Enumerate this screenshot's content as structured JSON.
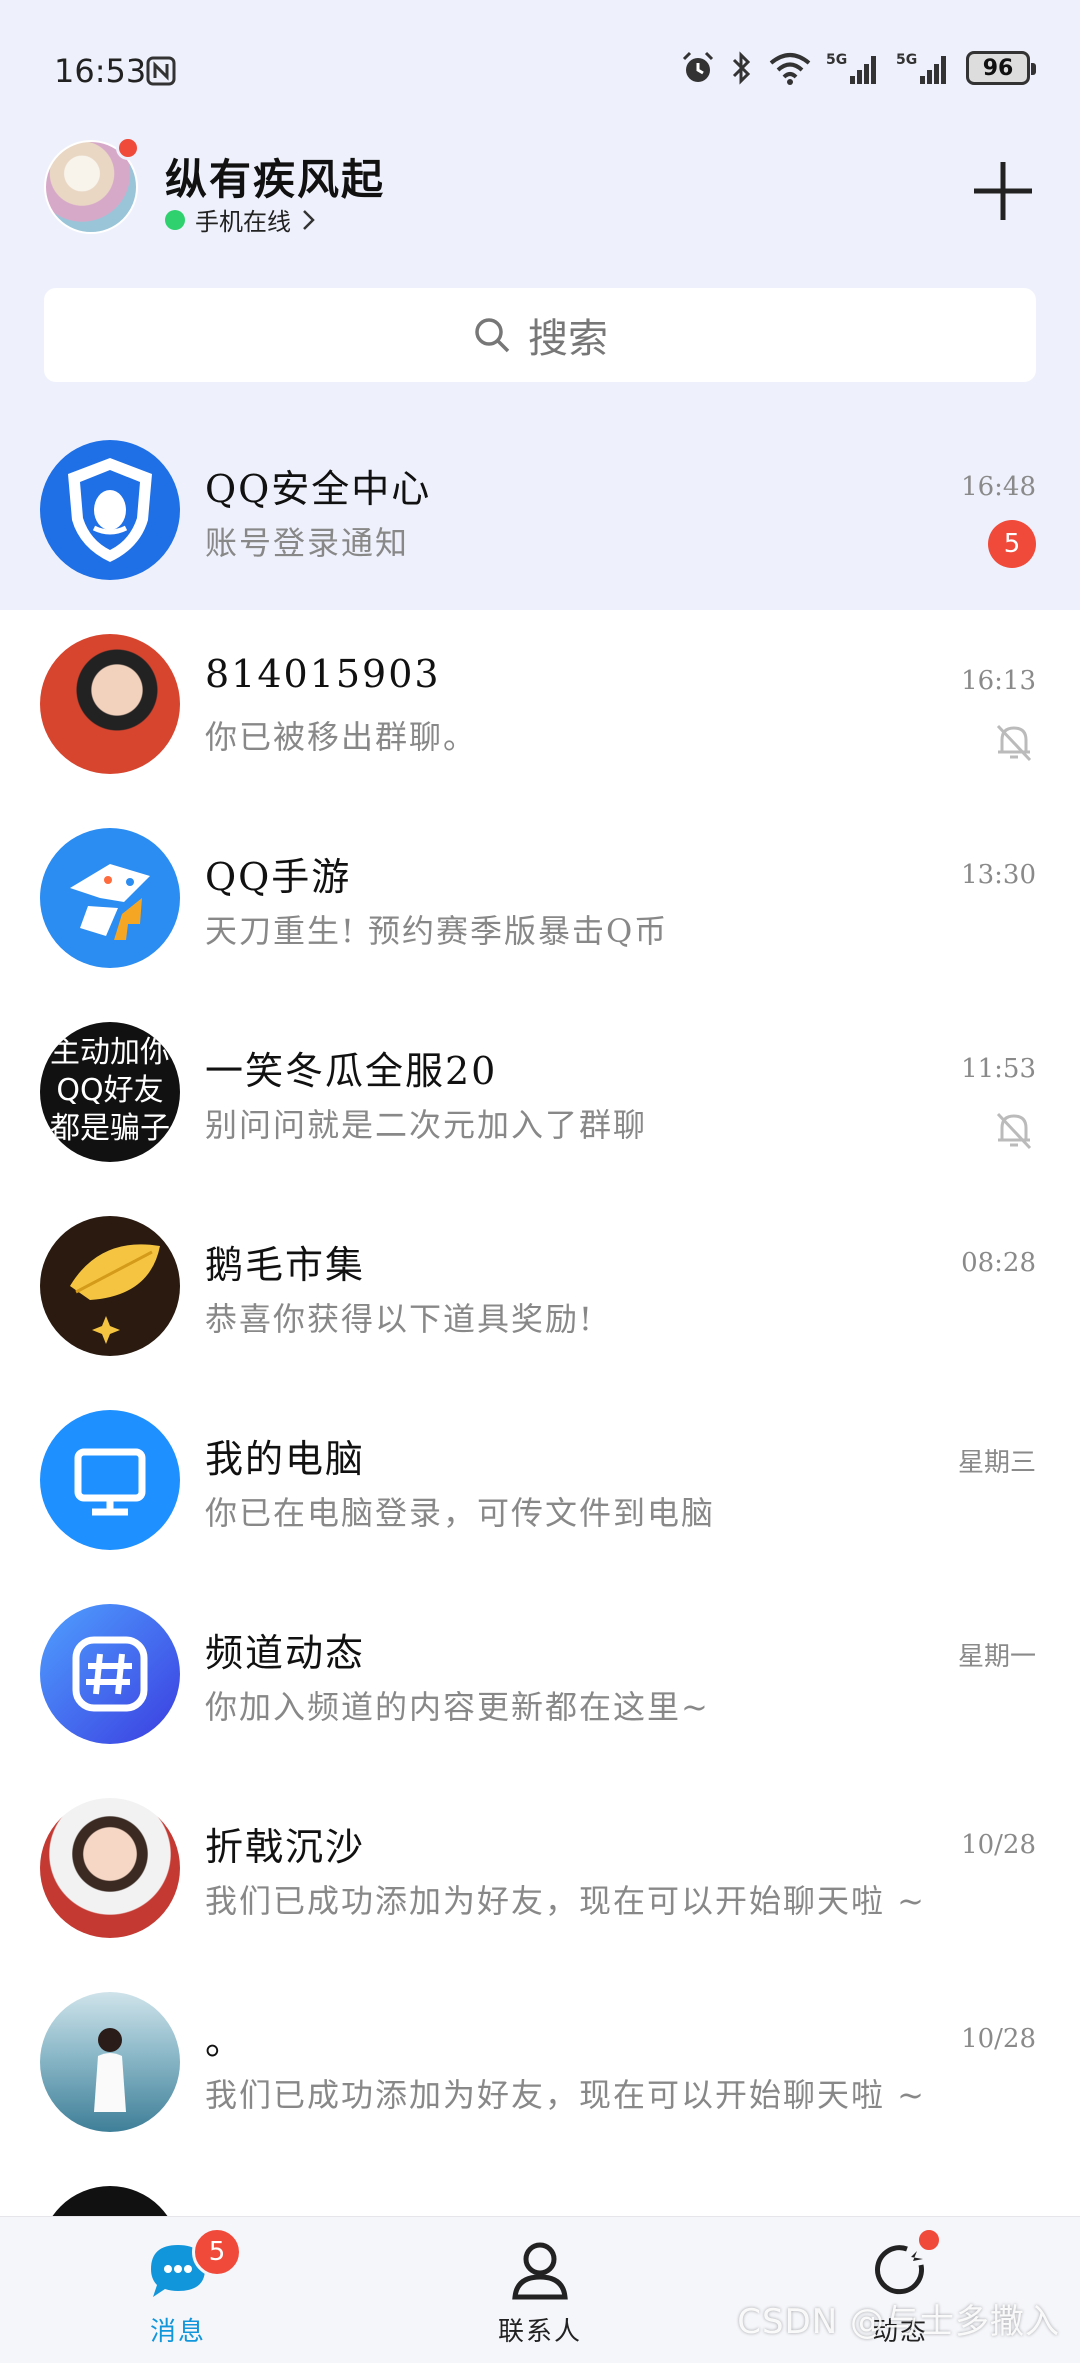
{
  "status_bar": {
    "time": "16:53",
    "battery": "96",
    "icons": [
      "nfc-icon",
      "alarm-icon",
      "bluetooth-icon",
      "wifi-icon",
      "signal-5g-icon",
      "signal-5g-icon",
      "battery-icon"
    ]
  },
  "header": {
    "username": "纵有疾风起",
    "status": "手机在线",
    "add_icon": "plus-icon"
  },
  "search": {
    "placeholder": "搜索"
  },
  "conversations": [
    {
      "name": "QQ安全中心",
      "preview": "账号登录通知",
      "time": "16:48",
      "unread": "5",
      "muted": false,
      "pinned": true,
      "avatar_color": "#1f6fe6"
    },
    {
      "name": "814015903",
      "preview": "你已被移出群聊。",
      "time": "16:13",
      "unread": "",
      "muted": true,
      "pinned": false,
      "avatar_color": "#d7452f"
    },
    {
      "name": "QQ手游",
      "preview": "天刀重生!  预约赛季版暴击Q币",
      "time": "13:30",
      "unread": "",
      "muted": false,
      "pinned": false,
      "avatar_color": "#2b8cf2"
    },
    {
      "name": "一笑冬瓜全服20",
      "preview": "别问问就是二次元加入了群聊",
      "time": "11:53",
      "unread": "",
      "muted": true,
      "pinned": false,
      "avatar_color": "#111111"
    },
    {
      "name": "鹅毛市集",
      "preview": "恭喜你获得以下道具奖励!",
      "time": "08:28",
      "unread": "",
      "muted": false,
      "pinned": false,
      "avatar_color": "#2a1a10"
    },
    {
      "name": "我的电脑",
      "preview": "你已在电脑登录，可传文件到电脑",
      "time": "星期三",
      "unread": "",
      "muted": false,
      "pinned": false,
      "avatar_color": "#1e90ff"
    },
    {
      "name": "频道动态",
      "preview": "你加入频道的内容更新都在这里~",
      "time": "星期一",
      "unread": "",
      "muted": false,
      "pinned": false,
      "avatar_color": "#3b6cf5"
    },
    {
      "name": "折戟沉沙",
      "preview": "我们已成功添加为好友，现在可以开始聊天啦 ~",
      "time": "10/28",
      "unread": "",
      "muted": false,
      "pinned": false,
      "avatar_color": "#c43a33"
    },
    {
      "name": "。",
      "preview": "我们已成功添加为好友，现在可以开始聊天啦 ~",
      "time": "10/28",
      "unread": "",
      "muted": false,
      "pinned": false,
      "avatar_color": "#5d9bb8"
    }
  ],
  "avatar_text": {
    "group_avatar_line1": "主动加你",
    "group_avatar_line2": "QQ好友",
    "group_avatar_line3": "都是骗子"
  },
  "bottom_nav": {
    "messages": {
      "label": "消息",
      "badge": "5",
      "color": "#1296db"
    },
    "contacts": {
      "label": "联系人"
    },
    "moments": {
      "label": "动态"
    }
  },
  "watermark": "CSDN @与士多撒入"
}
